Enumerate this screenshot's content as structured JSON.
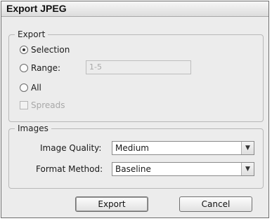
{
  "dialog": {
    "title": "Export JPEG"
  },
  "export_group": {
    "legend": "Export",
    "selection_label": "Selection",
    "range_label": "Range:",
    "range_value": "1-5",
    "all_label": "All",
    "spreads_label": "Spreads",
    "selected_option": "Selection"
  },
  "images_group": {
    "legend": "Images",
    "quality_label": "Image Quality:",
    "quality_value": "Medium",
    "format_label": "Format Method:",
    "format_value": "Baseline"
  },
  "buttons": {
    "export": "Export",
    "cancel": "Cancel"
  },
  "icons": {
    "dropdown": "chevron-down-icon"
  }
}
